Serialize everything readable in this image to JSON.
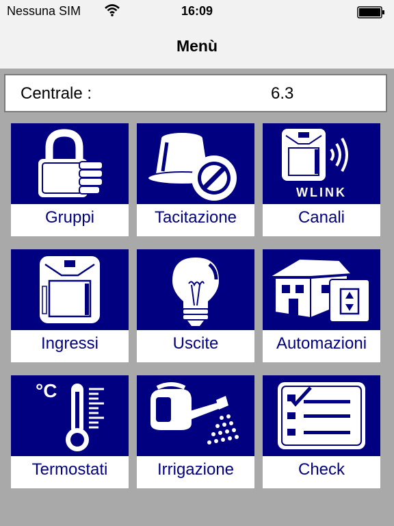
{
  "status_bar": {
    "carrier": "Nessuna SIM",
    "time": "16:09",
    "wifi_icon": "wifi-icon",
    "battery_icon": "battery-icon"
  },
  "nav": {
    "title": "Menù"
  },
  "info": {
    "label": "Centrale :",
    "value": "6.3"
  },
  "colors": {
    "tile_art": "#000080",
    "label_text": "#000080",
    "background": "#a9a9a9"
  },
  "tiles": [
    {
      "label": "Gruppi",
      "icon": "padlock-icon"
    },
    {
      "label": "Tacitazione",
      "icon": "muted-siren-icon"
    },
    {
      "label": "Canali",
      "icon": "wlink-device-icon",
      "badge": "WLINK"
    },
    {
      "label": "Ingressi",
      "icon": "sensor-device-icon"
    },
    {
      "label": "Uscite",
      "icon": "light-bulb-icon"
    },
    {
      "label": "Automazioni",
      "icon": "house-icon"
    },
    {
      "label": "Termostati",
      "icon": "thermometer-icon",
      "badge": "°C"
    },
    {
      "label": "Irrigazione",
      "icon": "watering-can-icon"
    },
    {
      "label": "Check",
      "icon": "checklist-icon"
    }
  ]
}
